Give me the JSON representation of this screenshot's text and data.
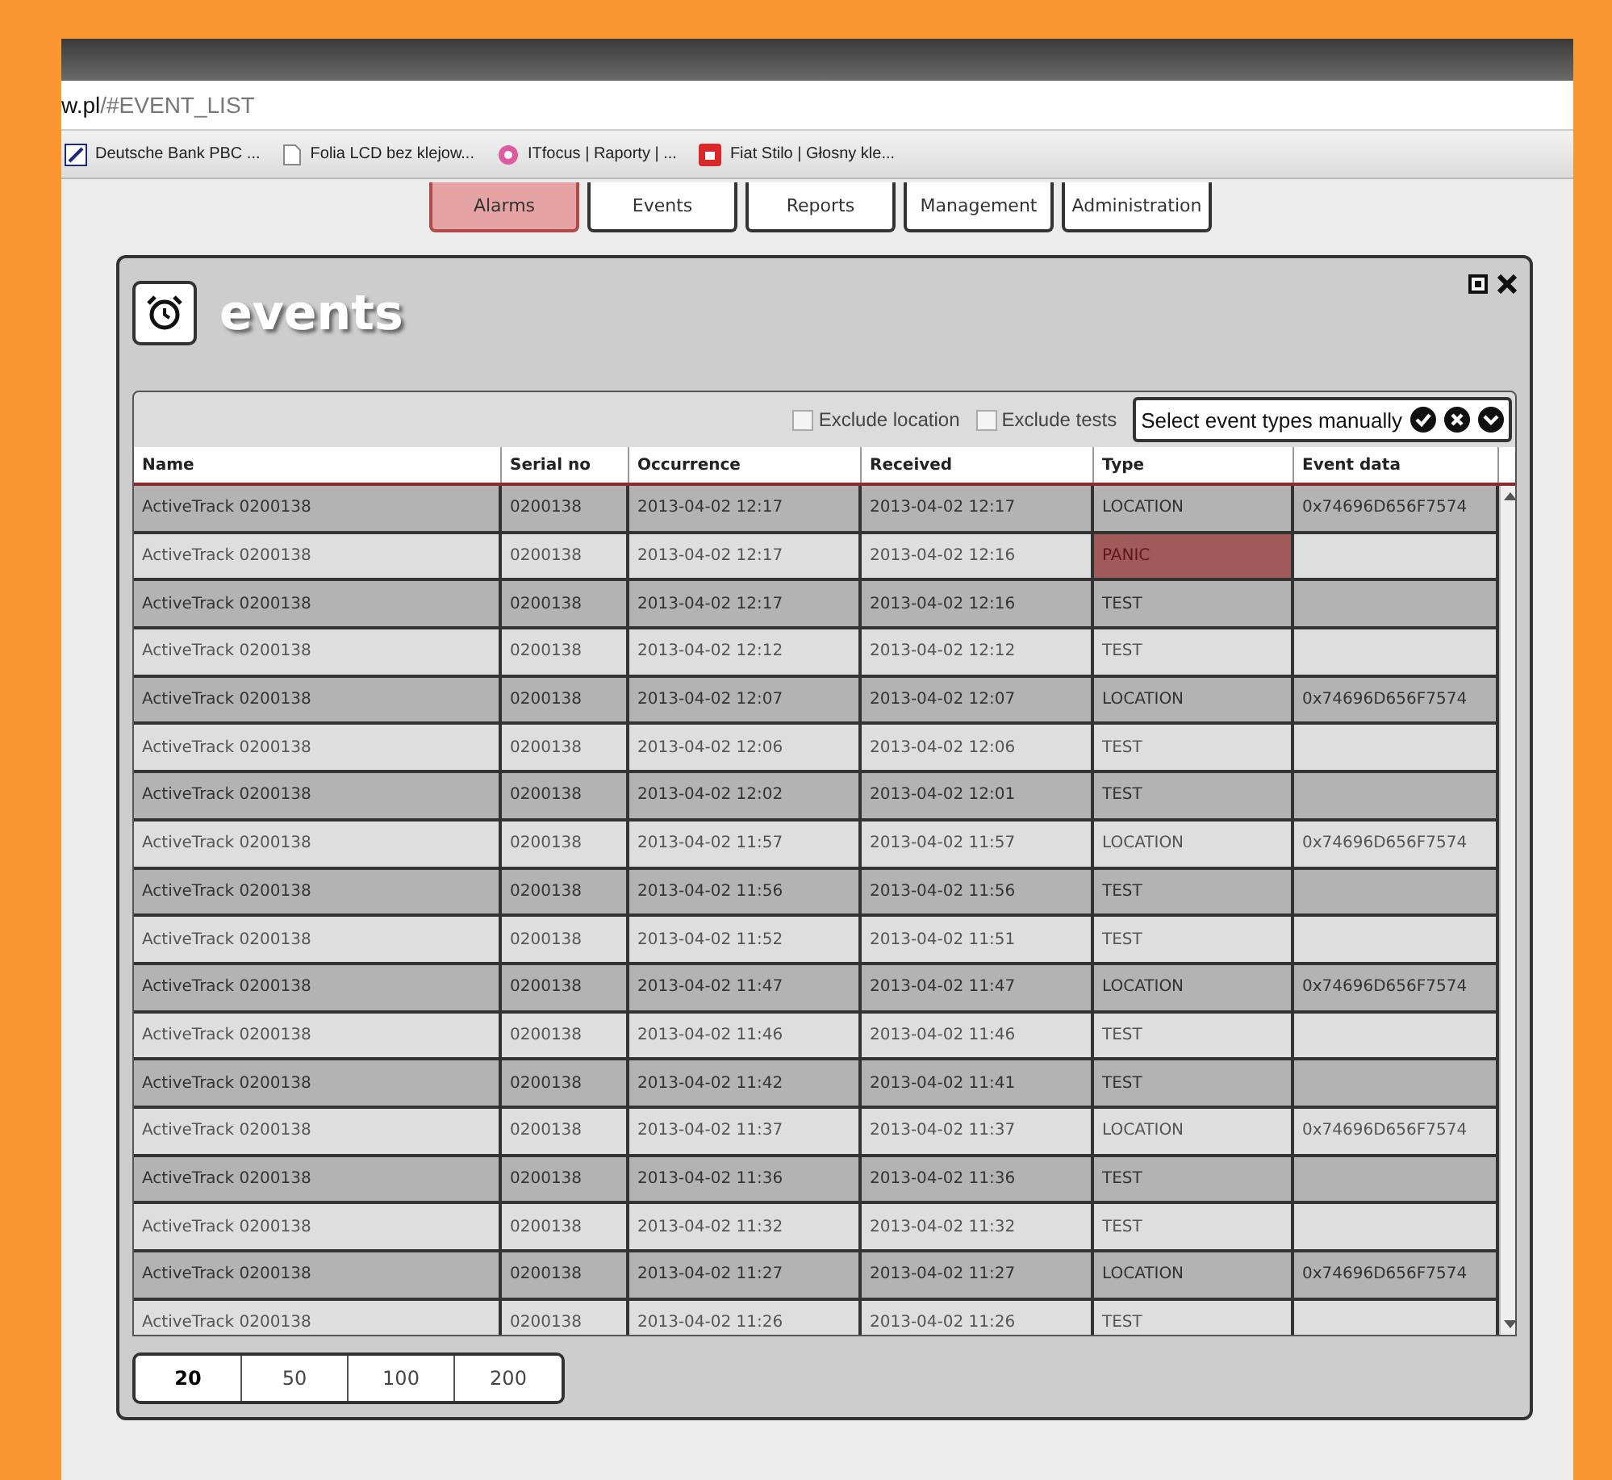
{
  "browser": {
    "url_host": "w.pl",
    "url_path": "/#EVENT_LIST",
    "bookmarks": [
      {
        "label": "Deutsche Bank PBC ...",
        "kind": "bank"
      },
      {
        "label": "Folia LCD bez klejow...",
        "kind": "page"
      },
      {
        "label": "ITfocus | Raporty | ...",
        "kind": "flower"
      },
      {
        "label": "Fiat Stilo | Głosny kle...",
        "kind": "red"
      }
    ]
  },
  "nav_tabs": [
    {
      "label": "Alarms",
      "selected": true
    },
    {
      "label": "Events",
      "selected": false
    },
    {
      "label": "Reports",
      "selected": false
    },
    {
      "label": "Management",
      "selected": false
    },
    {
      "label": "Administration",
      "selected": false
    }
  ],
  "panel": {
    "title": "events",
    "filters": [
      {
        "label": "Exclude location",
        "checked": false
      },
      {
        "label": "Exclude tests",
        "checked": false
      }
    ],
    "event_type_select": {
      "value": "Select event types manually"
    },
    "table": {
      "columns": [
        "Name",
        "Serial no",
        "Occurrence",
        "Received",
        "Type",
        "Event data"
      ],
      "rows": [
        {
          "cells": [
            "ActiveTrack 0200138",
            "0200138",
            "2013-04-02 12:17",
            "2013-04-02 12:17",
            "LOCATION",
            "0x74696D656F7574"
          ],
          "alert": false
        },
        {
          "cells": [
            "ActiveTrack 0200138",
            "0200138",
            "2013-04-02 12:17",
            "2013-04-02 12:16",
            "PANIC",
            ""
          ],
          "alert": true
        },
        {
          "cells": [
            "ActiveTrack 0200138",
            "0200138",
            "2013-04-02 12:17",
            "2013-04-02 12:16",
            "TEST",
            ""
          ],
          "alert": false
        },
        {
          "cells": [
            "ActiveTrack 0200138",
            "0200138",
            "2013-04-02 12:12",
            "2013-04-02 12:12",
            "TEST",
            ""
          ],
          "alert": false
        },
        {
          "cells": [
            "ActiveTrack 0200138",
            "0200138",
            "2013-04-02 12:07",
            "2013-04-02 12:07",
            "LOCATION",
            "0x74696D656F7574"
          ],
          "alert": false
        },
        {
          "cells": [
            "ActiveTrack 0200138",
            "0200138",
            "2013-04-02 12:06",
            "2013-04-02 12:06",
            "TEST",
            ""
          ],
          "alert": false
        },
        {
          "cells": [
            "ActiveTrack 0200138",
            "0200138",
            "2013-04-02 12:02",
            "2013-04-02 12:01",
            "TEST",
            ""
          ],
          "alert": false
        },
        {
          "cells": [
            "ActiveTrack 0200138",
            "0200138",
            "2013-04-02 11:57",
            "2013-04-02 11:57",
            "LOCATION",
            "0x74696D656F7574"
          ],
          "alert": false
        },
        {
          "cells": [
            "ActiveTrack 0200138",
            "0200138",
            "2013-04-02 11:56",
            "2013-04-02 11:56",
            "TEST",
            ""
          ],
          "alert": false
        },
        {
          "cells": [
            "ActiveTrack 0200138",
            "0200138",
            "2013-04-02 11:52",
            "2013-04-02 11:51",
            "TEST",
            ""
          ],
          "alert": false
        },
        {
          "cells": [
            "ActiveTrack 0200138",
            "0200138",
            "2013-04-02 11:47",
            "2013-04-02 11:47",
            "LOCATION",
            "0x74696D656F7574"
          ],
          "alert": false
        },
        {
          "cells": [
            "ActiveTrack 0200138",
            "0200138",
            "2013-04-02 11:46",
            "2013-04-02 11:46",
            "TEST",
            ""
          ],
          "alert": false
        },
        {
          "cells": [
            "ActiveTrack 0200138",
            "0200138",
            "2013-04-02 11:42",
            "2013-04-02 11:41",
            "TEST",
            ""
          ],
          "alert": false
        },
        {
          "cells": [
            "ActiveTrack 0200138",
            "0200138",
            "2013-04-02 11:37",
            "2013-04-02 11:37",
            "LOCATION",
            "0x74696D656F7574"
          ],
          "alert": false
        },
        {
          "cells": [
            "ActiveTrack 0200138",
            "0200138",
            "2013-04-02 11:36",
            "2013-04-02 11:36",
            "TEST",
            ""
          ],
          "alert": false
        },
        {
          "cells": [
            "ActiveTrack 0200138",
            "0200138",
            "2013-04-02 11:32",
            "2013-04-02 11:32",
            "TEST",
            ""
          ],
          "alert": false
        },
        {
          "cells": [
            "ActiveTrack 0200138",
            "0200138",
            "2013-04-02 11:27",
            "2013-04-02 11:27",
            "LOCATION",
            "0x74696D656F7574"
          ],
          "alert": false
        },
        {
          "cells": [
            "ActiveTrack 0200138",
            "0200138",
            "2013-04-02 11:26",
            "2013-04-02 11:26",
            "TEST",
            ""
          ],
          "alert": false
        }
      ]
    },
    "page_sizes": [
      {
        "label": "20",
        "selected": true
      },
      {
        "label": "50",
        "selected": false
      },
      {
        "label": "100",
        "selected": false
      },
      {
        "label": "200",
        "selected": false
      }
    ]
  }
}
